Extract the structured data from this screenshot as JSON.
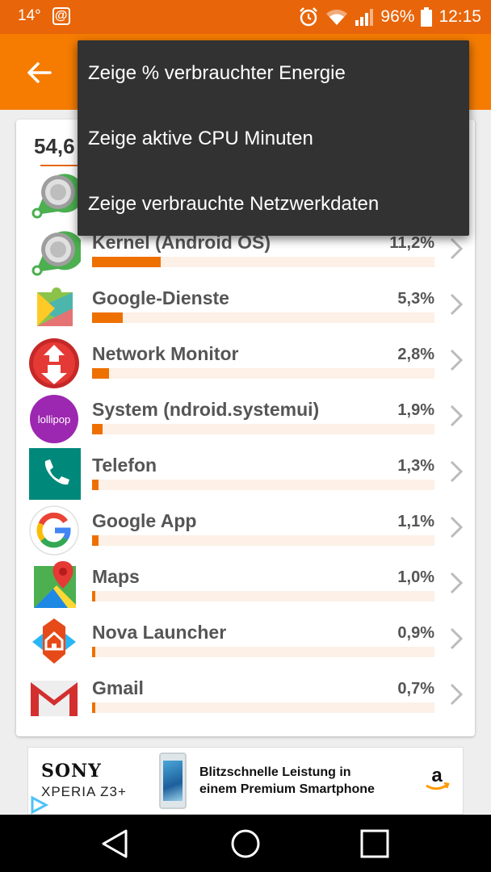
{
  "status": {
    "temperature": "14°",
    "notification_symbol": "@",
    "battery_level": "96%",
    "time": "12:15"
  },
  "appbar": {
    "back_icon": "arrow-back-icon"
  },
  "card": {
    "total": "54,6"
  },
  "apps": [
    {
      "name": "",
      "percent": "",
      "fill": 0.0,
      "icon": "android-os-icon"
    },
    {
      "name": "Kernel (Android OS)",
      "percent": "11,2%",
      "fill": 0.2,
      "icon": "android-os-icon"
    },
    {
      "name": "Google-Dienste",
      "percent": "5,3%",
      "fill": 0.09,
      "icon": "google-play-services-icon"
    },
    {
      "name": "Network Monitor",
      "percent": "2,8%",
      "fill": 0.05,
      "icon": "network-monitor-icon"
    },
    {
      "name": "System (ndroid.systemui)",
      "percent": "1,9%",
      "fill": 0.03,
      "icon": "lollipop-icon",
      "icon_text": "lollipop"
    },
    {
      "name": "Telefon",
      "percent": "1,3%",
      "fill": 0.02,
      "icon": "phone-app-icon"
    },
    {
      "name": "Google App",
      "percent": "1,1%",
      "fill": 0.02,
      "icon": "google-g-icon"
    },
    {
      "name": "Maps",
      "percent": "1,0%",
      "fill": 0.01,
      "icon": "google-maps-icon"
    },
    {
      "name": "Nova Launcher",
      "percent": "0,9%",
      "fill": 0.01,
      "icon": "nova-launcher-icon"
    },
    {
      "name": "Gmail",
      "percent": "0,7%",
      "fill": 0.01,
      "icon": "gmail-icon"
    }
  ],
  "menu": {
    "items": [
      {
        "label": "Zeige % verbrauchter Energie"
      },
      {
        "label": "Zeige aktive CPU Minuten"
      },
      {
        "label": "Zeige verbrauchte Netzwerkdaten"
      }
    ]
  },
  "ad": {
    "brand": "SONY",
    "model": "XPERIA Z3+",
    "line1": "Blitzschnelle Leistung in",
    "line2": "einem Premium Smartphone",
    "advertiser_icon": "amazon-icon"
  },
  "colors": {
    "status_bar": "#e8650a",
    "app_bar": "#f57c00",
    "bar_fill": "#ee7000",
    "bar_track": "#fdf0e6",
    "menu_bg": "#323232"
  }
}
